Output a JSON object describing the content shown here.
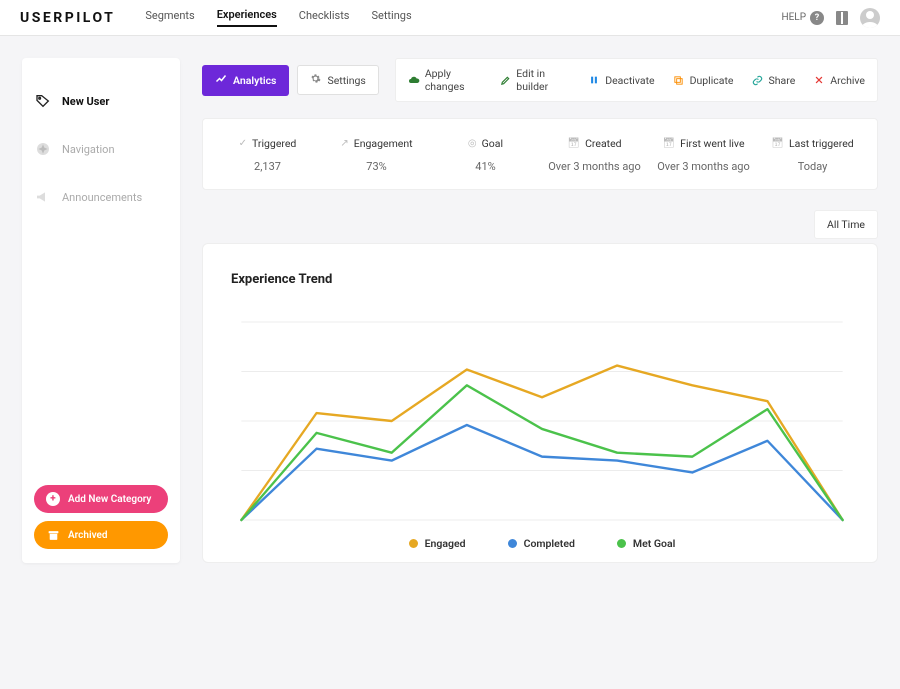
{
  "brand": "USERPILOT",
  "nav": {
    "items": [
      "Segments",
      "Experiences",
      "Checklists",
      "Settings"
    ],
    "active": "Experiences",
    "help_label": "HELP"
  },
  "sidebar": {
    "items": [
      {
        "label": "New User",
        "icon": "tag-icon",
        "active": true
      },
      {
        "label": "Navigation",
        "icon": "compass-icon",
        "active": false
      },
      {
        "label": "Announcements",
        "icon": "megaphone-icon",
        "active": false
      }
    ],
    "add_label": "Add New Category",
    "archived_label": "Archived"
  },
  "tabs": {
    "analytics": "Analytics",
    "settings": "Settings"
  },
  "toolbar": {
    "apply": "Apply changes",
    "edit": "Edit in builder",
    "deactivate": "Deactivate",
    "duplicate": "Duplicate",
    "share": "Share",
    "archive": "Archive"
  },
  "stats": {
    "triggered": {
      "label": "Triggered",
      "value": "2,137"
    },
    "engagement": {
      "label": "Engagement",
      "value": "73%"
    },
    "goal": {
      "label": "Goal",
      "value": "41%"
    },
    "created": {
      "label": "Created",
      "value": "Over 3 months ago"
    },
    "first_live": {
      "label": "First went live",
      "value": "Over 3 months ago"
    },
    "last_triggered": {
      "label": "Last triggered",
      "value": "Today"
    }
  },
  "filter": {
    "time_range": "All Time"
  },
  "chart": {
    "title": "Experience Trend",
    "legend": {
      "engaged": "Engaged",
      "completed": "Completed",
      "metgoal": "Met Goal"
    }
  },
  "colors": {
    "engaged": "#e6a823",
    "completed": "#3f87d9",
    "metgoal": "#4bc24b",
    "grid": "#ececec"
  },
  "chart_data": {
    "type": "line",
    "title": "Experience Trend",
    "x": [
      1,
      2,
      3,
      4,
      5,
      6,
      7,
      8,
      9
    ],
    "ylim": [
      0,
      100
    ],
    "series": [
      {
        "name": "Engaged",
        "color": "#e6a823",
        "values": [
          0,
          54,
          50,
          76,
          62,
          78,
          68,
          60,
          0
        ]
      },
      {
        "name": "Completed",
        "color": "#3f87d9",
        "values": [
          0,
          36,
          30,
          48,
          32,
          30,
          24,
          40,
          0
        ]
      },
      {
        "name": "Met Goal",
        "color": "#4bc24b",
        "values": [
          0,
          44,
          34,
          68,
          46,
          34,
          32,
          56,
          0
        ]
      }
    ],
    "xlabel": "",
    "ylabel": "",
    "grid": true,
    "legend_position": "bottom"
  }
}
